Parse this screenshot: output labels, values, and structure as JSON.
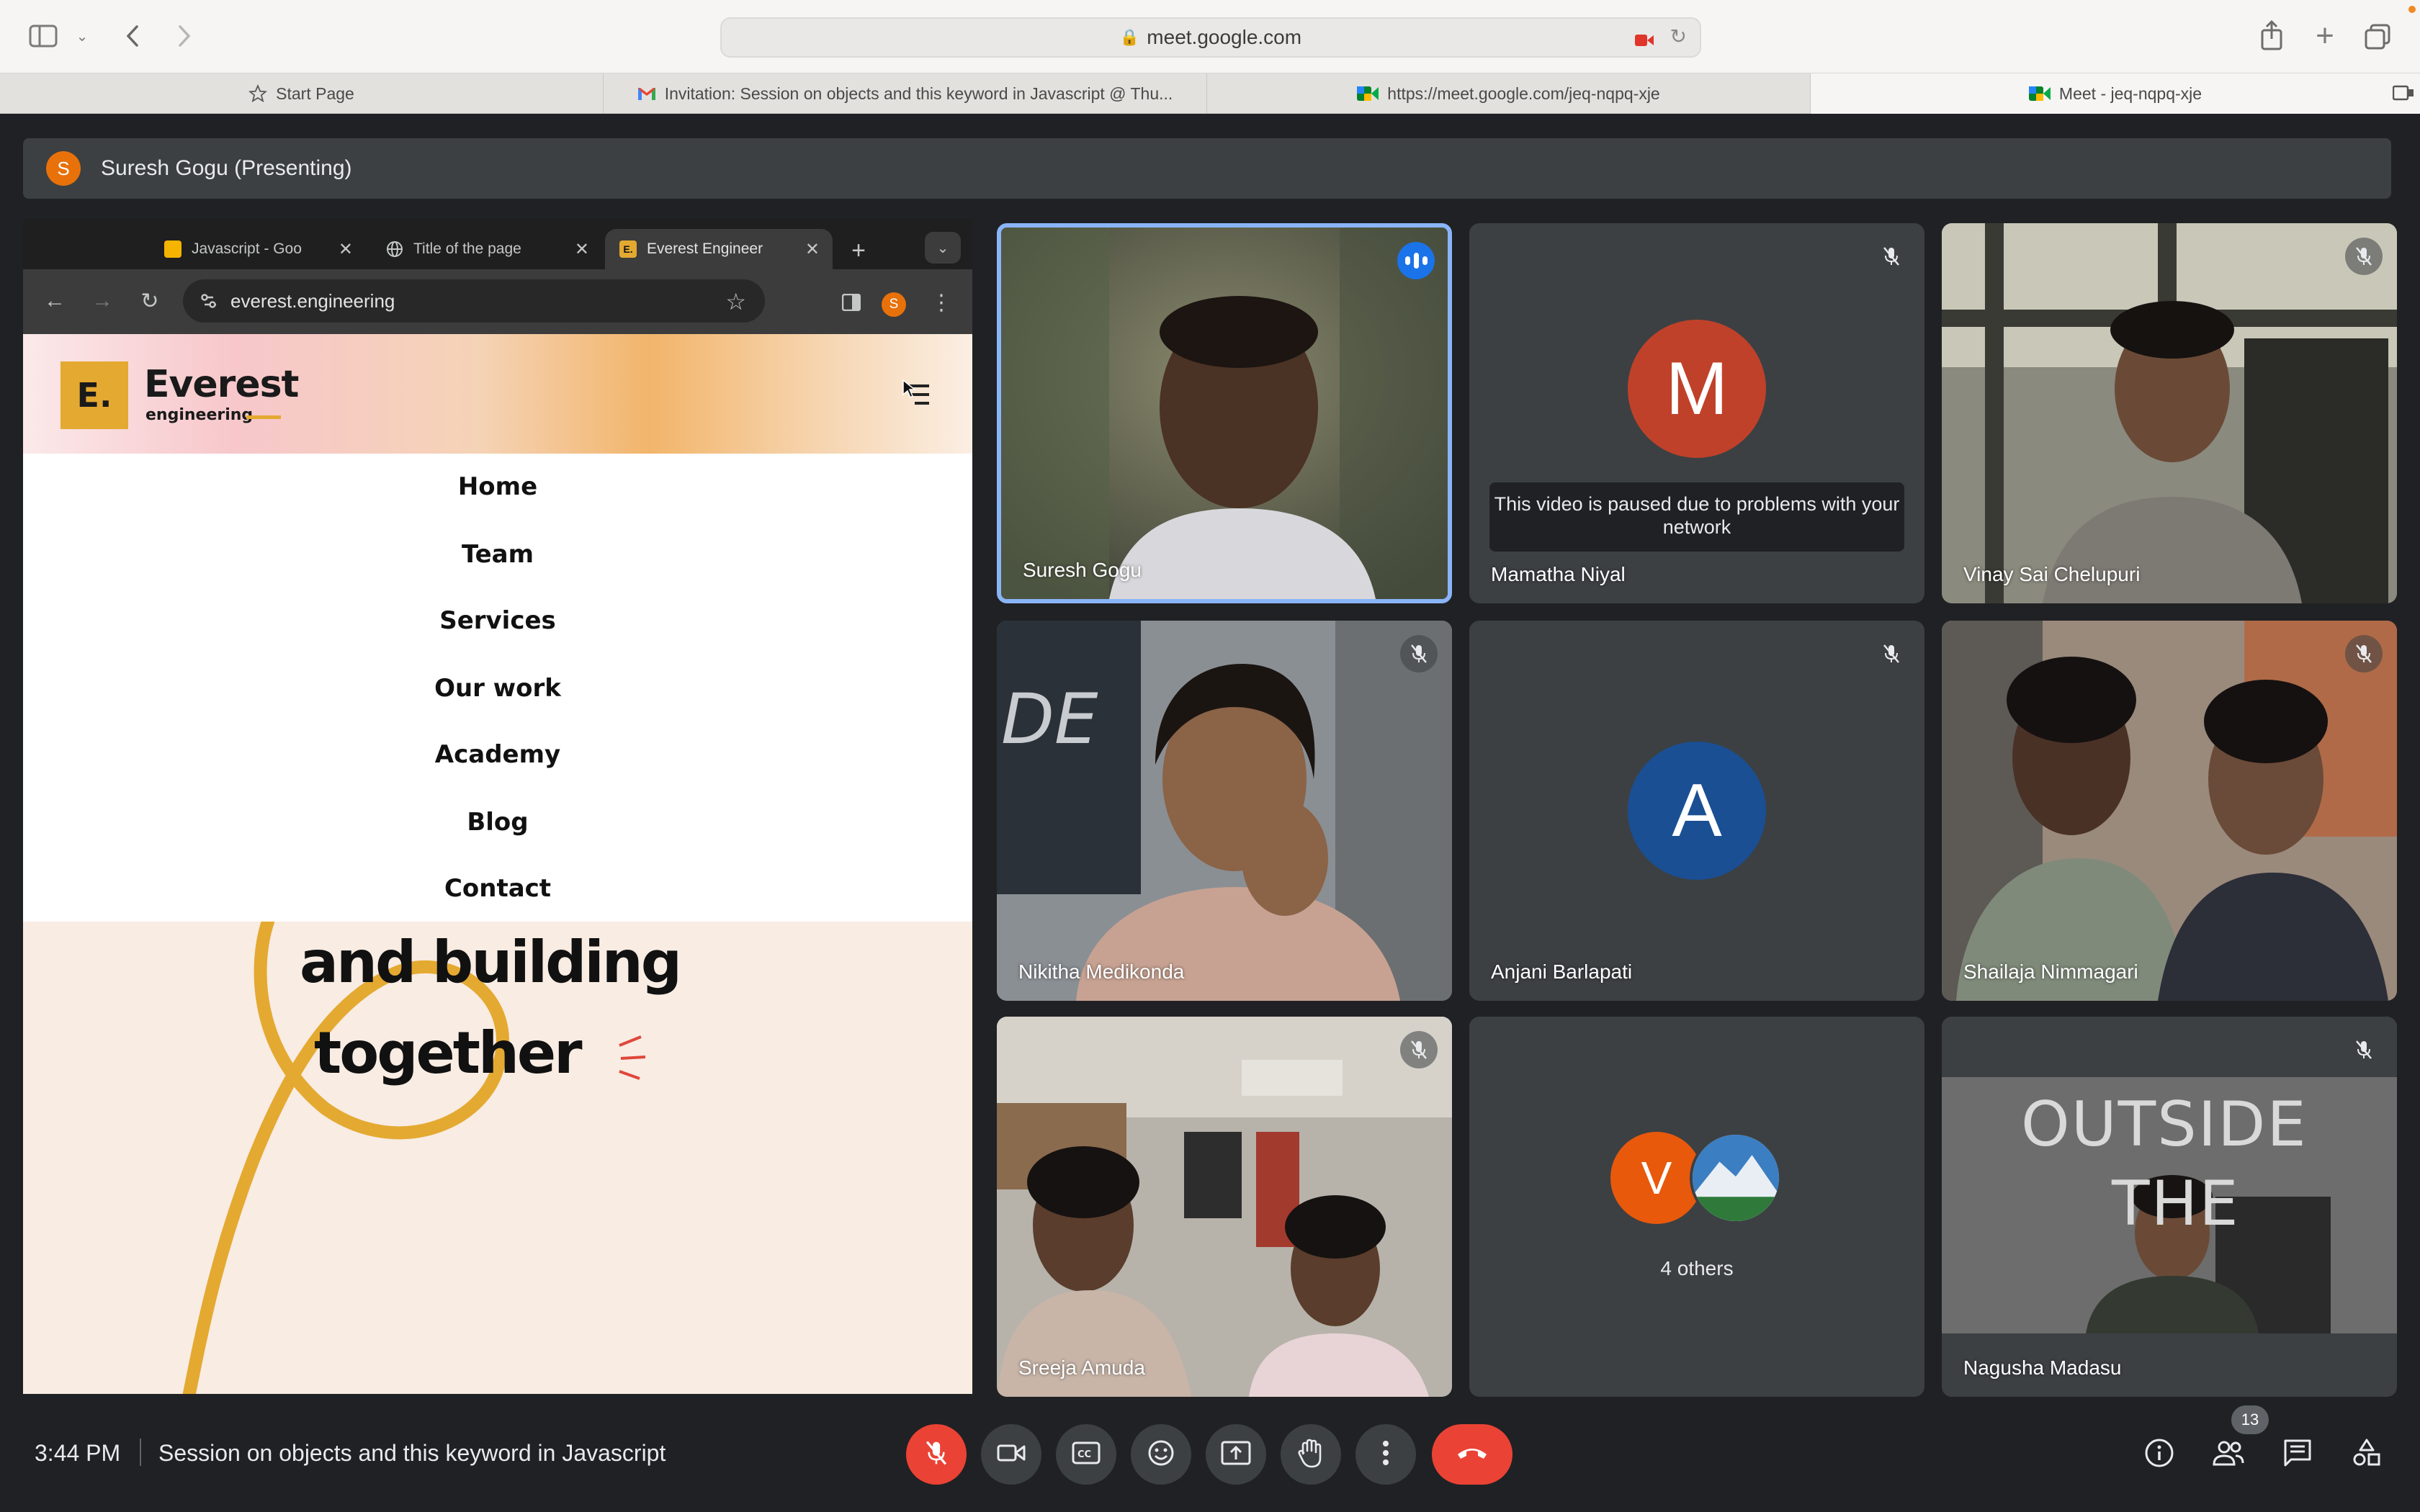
{
  "browser": {
    "address": "meet.google.com",
    "tabs": [
      {
        "title": "Start Page",
        "icon": "star-icon"
      },
      {
        "title": "Invitation: Session on objects and this keyword in Javascript @ Thu...",
        "icon": "gmail-icon"
      },
      {
        "title": "https://meet.google.com/jeq-nqpq-xje",
        "icon": "meet-icon"
      },
      {
        "title": "Meet - jeq-nqpq-xje",
        "icon": "meet-icon",
        "active": true
      }
    ]
  },
  "meet": {
    "presenting": {
      "avatar_letter": "S",
      "label": "Suresh Gogu (Presenting)"
    },
    "shared_screen": {
      "tabs": [
        {
          "title": "Javascript - Goo",
          "icon": "slides-icon"
        },
        {
          "title": "Title of the page",
          "icon": "globe-icon"
        },
        {
          "title": "Everest Engineer",
          "icon": "everest-favicon",
          "active": true
        }
      ],
      "url": "everest.engineering",
      "profile_letter": "S",
      "site": {
        "logo_mark": "E.",
        "logo_name": "Everest",
        "logo_sub": "engineering",
        "nav": [
          "Home",
          "Team",
          "Services",
          "Our work",
          "Academy",
          "Blog",
          "Contact"
        ],
        "hero_lines": [
          "and building",
          "together"
        ]
      }
    },
    "participants": [
      {
        "name": "Suresh Gogu",
        "state": "speaking",
        "video": true
      },
      {
        "name": "Mamatha Niyal",
        "state": "muted",
        "video": false,
        "avatar_letter": "M",
        "avatar_color": "#c0412a",
        "notice": "This video is paused due to problems with your network"
      },
      {
        "name": "Vinay Sai Chelupuri",
        "state": "muted",
        "video": true
      },
      {
        "name": "Nikitha Medikonda",
        "state": "muted",
        "video": true
      },
      {
        "name": "Anjani Barlapati",
        "state": "muted",
        "video": false,
        "avatar_letter": "A",
        "avatar_color": "#1a4f94"
      },
      {
        "name": "Shailaja Nimmagari",
        "state": "muted",
        "video": true
      },
      {
        "name": "Sreeja Amuda",
        "state": "muted",
        "video": true
      },
      {
        "name": "Nagusha Madasu",
        "state": "muted",
        "video": true,
        "backdrop_text": [
          "OUTSIDE",
          "THE"
        ]
      }
    ],
    "others": {
      "label": "4 others",
      "avatar_letter": "V",
      "avatar_color": "#e8590c"
    },
    "bottom_bar": {
      "time": "3:44 PM",
      "title": "Session on objects and this keyword in Javascript",
      "people_count": "13"
    }
  }
}
